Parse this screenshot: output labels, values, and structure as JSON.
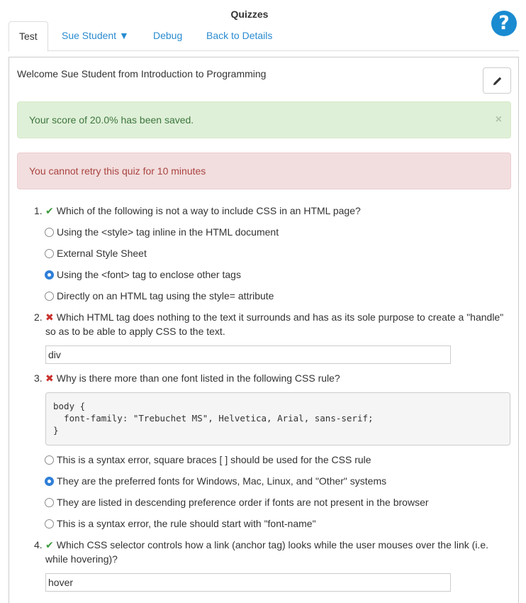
{
  "header": {
    "title": "Quizzes",
    "help_glyph": "?"
  },
  "tabs": [
    {
      "label": "Test"
    },
    {
      "label": "Sue Student ▼"
    },
    {
      "label": "Debug"
    },
    {
      "label": "Back to Details"
    }
  ],
  "welcome": "Welcome Sue Student from Introduction to Programming",
  "alerts": {
    "success": "Your score of 20.0% has been saved.",
    "close_glyph": "×",
    "danger": "You cannot retry this quiz for 10 minutes"
  },
  "questions": [
    {
      "number": "1.",
      "mark": "✔",
      "text": "Which of the following is not a way to include CSS in an HTML page?",
      "options": [
        "Using the <style> tag inline in the HTML document",
        "External Style Sheet",
        "Using the <font> tag to enclose other tags",
        "Directly on an HTML tag using the style= attribute"
      ],
      "selected": 2
    },
    {
      "number": "2.",
      "mark": "✖",
      "text": "Which HTML tag does nothing to the text it surrounds and has as its sole purpose to create a \"handle\" so as to be able to apply CSS to the text.",
      "answer": "div"
    },
    {
      "number": "3.",
      "mark": "✖",
      "text": "Why is there more than one font listed in the following CSS rule?",
      "code": "body {\n  font-family: \"Trebuchet MS\", Helvetica, Arial, sans-serif;\n}",
      "options": [
        "This is a syntax error, square braces [ ] should be used for the CSS rule",
        "They are the preferred fonts for Windows, Mac, Linux, and \"Other\" systems",
        "They are listed in descending preference order if fonts are not present in the browser",
        "This is a syntax error, the rule should start with \"font-name\""
      ],
      "selected": 1
    },
    {
      "number": "4.",
      "mark": "✔",
      "text": "Which CSS selector controls how a link (anchor tag) looks while the user mouses over the link (i.e. while hovering)?",
      "answer": "hover"
    }
  ],
  "icons": {
    "help": "question-circle-icon",
    "edit": "pencil-icon",
    "correct": "check-icon",
    "incorrect": "x-icon"
  },
  "colors": {
    "link": "#2a8bd0",
    "help_bg": "#1a8bd1",
    "success_bg": "#dff0d8",
    "success_text": "#3c763d",
    "danger_bg": "#f2dede",
    "danger_text": "#a94442",
    "correct_mark": "#3c9a3c",
    "incorrect_mark": "#c9302c",
    "radio_checked": "#2f7fd8"
  }
}
